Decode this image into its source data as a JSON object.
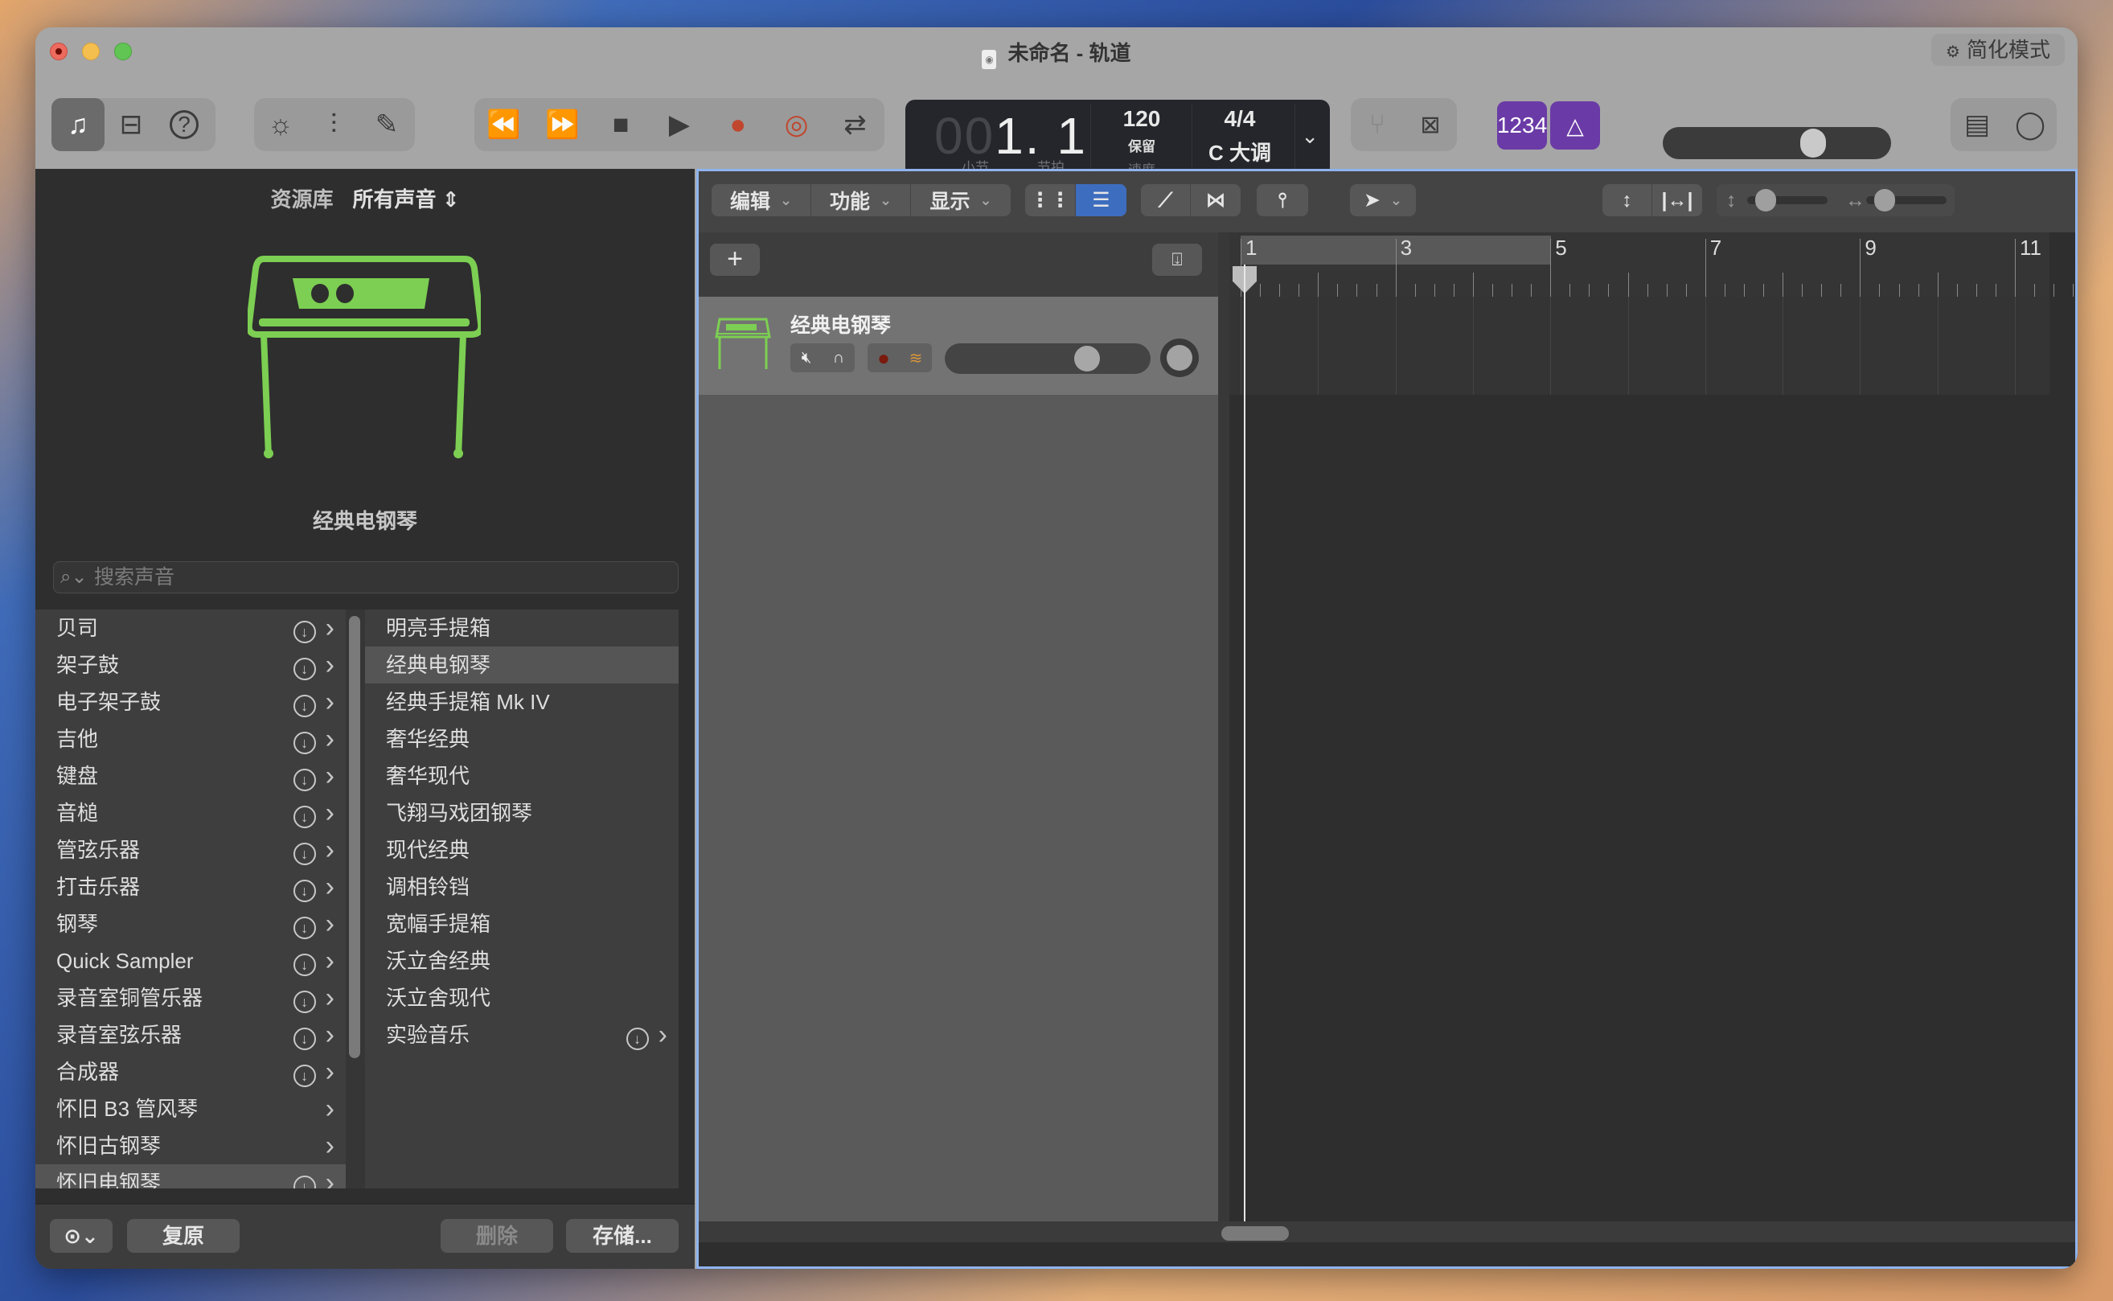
{
  "window": {
    "title": "未命名 - 轨道",
    "simple_mode_label": "简化模式"
  },
  "toolbar": {
    "left_group": [
      "library-icon",
      "smart-controls-icon",
      "help-icon"
    ],
    "middle_group": [
      "settings-dial-icon",
      "mixer-icon",
      "pencil-icon"
    ],
    "transport": [
      "rewind-icon",
      "fast-forward-icon",
      "stop-icon",
      "play-icon",
      "record-icon",
      "capture-record-icon",
      "cycle-icon"
    ],
    "lcd": {
      "bar_dim": "00",
      "position": "1. 1",
      "bar_label": "小节",
      "beat_label": "节拍",
      "tempo": "120",
      "tempo_mode": "保留",
      "tempo_label": "速度",
      "time_signature": "4/4",
      "key": "C 大调"
    },
    "count_in_label": "1234",
    "master_volume": 0.68,
    "accent_color": "#6a3aa6",
    "lcd_bar_color": "#c8832f"
  },
  "library": {
    "title": "资源库",
    "filter": "所有声音",
    "selected_patch": "经典电钢琴",
    "search_placeholder": "搜索声音",
    "categories": [
      {
        "label": "贝司",
        "download": true
      },
      {
        "label": "架子鼓",
        "download": true
      },
      {
        "label": "电子架子鼓",
        "download": true
      },
      {
        "label": "吉他",
        "download": true
      },
      {
        "label": "键盘",
        "download": true
      },
      {
        "label": "音槌",
        "download": true
      },
      {
        "label": "管弦乐器",
        "download": true
      },
      {
        "label": "打击乐器",
        "download": true
      },
      {
        "label": "钢琴",
        "download": true
      },
      {
        "label": "Quick Sampler",
        "download": true
      },
      {
        "label": "录音室铜管乐器",
        "download": true
      },
      {
        "label": "录音室弦乐器",
        "download": true
      },
      {
        "label": "合成器",
        "download": true
      },
      {
        "label": "怀旧 B3 管风琴",
        "download": false
      },
      {
        "label": "怀旧古钢琴",
        "download": false
      },
      {
        "label": "怀旧电钢琴",
        "download": true,
        "selected": true
      }
    ],
    "patches": [
      {
        "label": "明亮手提箱"
      },
      {
        "label": "经典电钢琴",
        "selected": true
      },
      {
        "label": "经典手提箱 Mk IV"
      },
      {
        "label": "奢华经典"
      },
      {
        "label": "奢华现代"
      },
      {
        "label": "飞翔马戏团钢琴"
      },
      {
        "label": "现代经典"
      },
      {
        "label": "调相铃铛"
      },
      {
        "label": "宽幅手提箱"
      },
      {
        "label": "沃立舍经典"
      },
      {
        "label": "沃立舍现代"
      },
      {
        "label": "实验音乐",
        "download": true,
        "folder": true
      }
    ],
    "footer": {
      "revert": "复原",
      "delete": "删除",
      "save": "存储..."
    },
    "instrument_color": "#7ccf52"
  },
  "tracks": {
    "menus": [
      "编辑",
      "功能",
      "显示"
    ],
    "ruler_marks": [
      "1",
      "3",
      "5",
      "7",
      "9",
      "11"
    ],
    "track_list": [
      {
        "name": "经典电钢琴",
        "volume": 0.72,
        "pan": 0
      }
    ]
  }
}
